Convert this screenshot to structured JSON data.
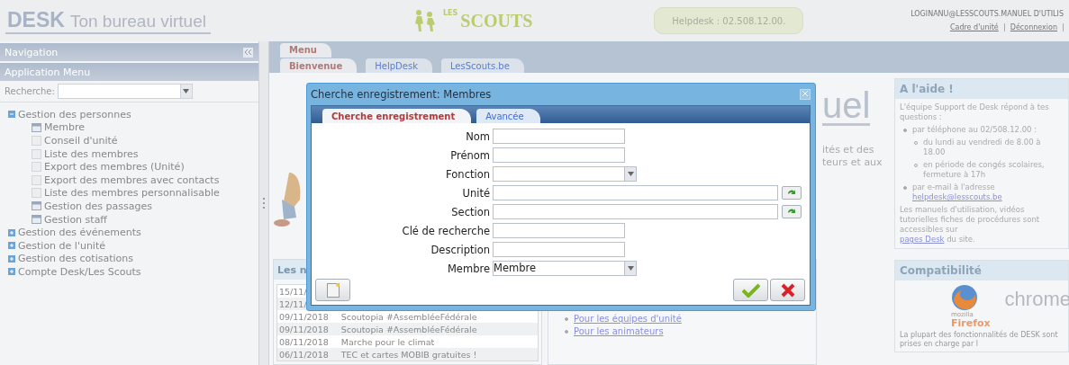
{
  "header": {
    "logo_main": "DESK",
    "logo_sub": "Ton bureau virtuel",
    "brand_small": "LES",
    "brand": "SCOUTS",
    "helpdesk": "Helpdesk : 02.508.12.00.",
    "user": "LOGINANU@LESSCOUTS.MANUEL D'UTILIS",
    "links": [
      "Cadre d'unité",
      "Déconnexion"
    ]
  },
  "sidebar": {
    "title": "Navigation",
    "section": "Application Menu",
    "search_label": "Recherche:",
    "tree": [
      {
        "label": "Gestion des personnes",
        "expanded": true,
        "children": [
          {
            "label": "Membre",
            "kind": "window"
          },
          {
            "label": "Conseil d'unité",
            "kind": "page"
          },
          {
            "label": "Liste des membres",
            "kind": "page"
          },
          {
            "label": "Export des membres (Unité)",
            "kind": "page"
          },
          {
            "label": "Export des membres avec contacts",
            "kind": "page"
          },
          {
            "label": "Liste des membres personnalisable",
            "kind": "page"
          },
          {
            "label": "Gestion des passages",
            "kind": "window"
          },
          {
            "label": "Gestion staff",
            "kind": "window"
          }
        ]
      },
      {
        "label": "Gestion des événements",
        "expanded": false
      },
      {
        "label": "Gestion de l'unité",
        "expanded": false
      },
      {
        "label": "Gestion des cotisations",
        "expanded": false
      },
      {
        "label": "Compte Desk/Les Scouts",
        "expanded": false
      }
    ]
  },
  "main_tabs": [
    {
      "label": "Menu",
      "selected": true
    }
  ],
  "sub_tabs": [
    {
      "label": "Bienvenue",
      "selected": true
    },
    {
      "label": "HelpDesk",
      "selected": false
    },
    {
      "label": "LesScouts.be",
      "selected": false
    }
  ],
  "welcome": {
    "logo_fragment": "uel",
    "lines": [
      "ités et des",
      "teurs et aux"
    ]
  },
  "news": {
    "title": "Les n",
    "rows": [
      {
        "date": "15/11/"
      },
      {
        "date": "12/11/"
      },
      {
        "date": "09/11/2018",
        "title": "Scoutopia #AssembléeFédérale"
      },
      {
        "date": "09/11/2018",
        "title": "Scoutopia #AssembléeFédérale"
      },
      {
        "date": "08/11/2018",
        "title": "Marche pour le climat"
      },
      {
        "date": "06/11/2018",
        "title": "TEC et cartes MOBIB gratuites !"
      }
    ]
  },
  "guides": {
    "links": [
      "Pour les équipes d'unité",
      "Pour les animateurs"
    ]
  },
  "help": {
    "title": "A l'aide !",
    "intro": "L'équipe Support de Desk répond à tes questions :",
    "phone": "par téléphone au 02/508.12.00 :",
    "hours": [
      "du lundi au vendredi de 8.00 à 18.00",
      "en période de congés scolaires, fermeture à 17h"
    ],
    "email": "par e-mail à l'adresse",
    "email_link": "helpdesk@lesscouts.be",
    "manuals": "Les manuels d'utilisation, vidéos tutorielles fiches de procédures sont accessibles sur",
    "manuals_link": "pages Desk",
    "manuals_end": "du site."
  },
  "compat": {
    "title": "Compatibilité",
    "chrome": "chrome",
    "firefox_small": "mozilla",
    "firefox": "Firefox",
    "text": "La plupart des fonctionnalités de DESK sont prises en charge par l"
  },
  "dialog": {
    "title": "Cherche enregistrement: Membres",
    "tabs": [
      {
        "label": "Cherche enregistrement",
        "selected": true
      },
      {
        "label": "Avancée",
        "selected": false
      }
    ],
    "fields": [
      {
        "label": "Nom",
        "kind": "text"
      },
      {
        "label": "Prénom",
        "kind": "text"
      },
      {
        "label": "Fonction",
        "kind": "select"
      },
      {
        "label": "Unité",
        "kind": "lookup"
      },
      {
        "label": "Section",
        "kind": "lookup"
      },
      {
        "label": "Clé de recherche",
        "kind": "text"
      },
      {
        "label": "Description",
        "kind": "text"
      },
      {
        "label": "Membre",
        "kind": "select",
        "value": "Membre"
      }
    ]
  }
}
